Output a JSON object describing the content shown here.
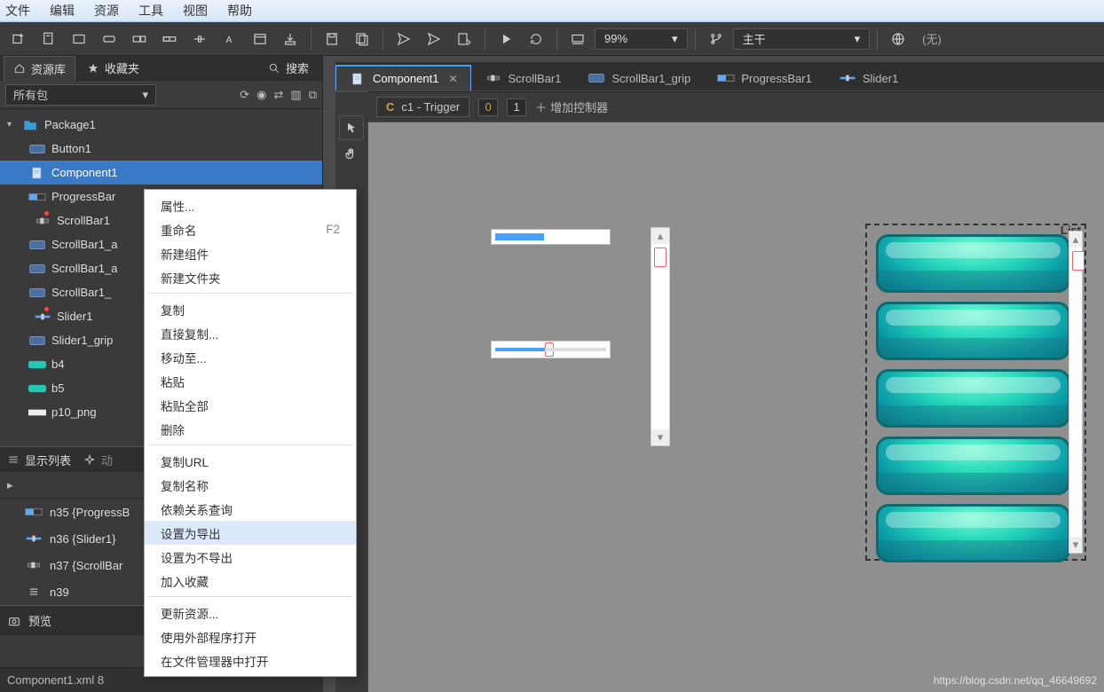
{
  "menubar": [
    "文件",
    "编辑",
    "资源",
    "工具",
    "视图",
    "帮助"
  ],
  "toolbar": {
    "zoom": "99%",
    "trunk": "主干",
    "tone": "(无)"
  },
  "libtabs": {
    "library": "资源库",
    "favorites": "收藏夹",
    "search": "搜索"
  },
  "pkg_selector": "所有包",
  "tree": {
    "root": "Package1",
    "items": [
      {
        "label": "Button1",
        "icon": "button"
      },
      {
        "label": "Component1",
        "icon": "component",
        "selected": true
      },
      {
        "label": "ProgressBar",
        "icon": "progress",
        "truncated": true
      },
      {
        "label": "ScrollBar1",
        "icon": "scrollbar",
        "dot": true
      },
      {
        "label": "ScrollBar1_a",
        "icon": "button",
        "truncated": true
      },
      {
        "label": "ScrollBar1_a",
        "icon": "button",
        "truncated": true
      },
      {
        "label": "ScrollBar1_",
        "icon": "button",
        "truncated": true
      },
      {
        "label": "Slider1",
        "icon": "slider",
        "dot": true
      },
      {
        "label": "Slider1_grip",
        "icon": "button",
        "truncated": true
      },
      {
        "label": "b4",
        "icon": "img-teal"
      },
      {
        "label": "b5",
        "icon": "img-teal"
      },
      {
        "label": "p10_png",
        "icon": "img-white"
      }
    ]
  },
  "disp": {
    "title": "显示列表",
    "anim_tab": "动",
    "items": [
      "n35 {ProgressB",
      "n36 {Slider1}",
      "n37 {ScrollBar",
      "n39"
    ],
    "preview": "预览"
  },
  "status": "Component1.xml  8",
  "tabs": [
    {
      "label": "Component1",
      "active": true,
      "icon": "component",
      "close": true
    },
    {
      "label": "ScrollBar1",
      "icon": "scrollbar"
    },
    {
      "label": "ScrollBar1_grip",
      "icon": "button"
    },
    {
      "label": "ProgressBar1",
      "icon": "progress"
    },
    {
      "label": "Slider1",
      "icon": "slider"
    }
  ],
  "controller": {
    "chip_prefix": "C",
    "chip_text": "c1 - Trigger",
    "box0": "0",
    "box1": "1",
    "add": "增加控制器"
  },
  "list_label": "List",
  "contextmenu": [
    {
      "label": "属性...",
      "type": "item"
    },
    {
      "label": "重命名",
      "accel": "F2",
      "type": "item"
    },
    {
      "label": "新建组件",
      "type": "item"
    },
    {
      "label": "新建文件夹",
      "type": "item"
    },
    {
      "type": "sep"
    },
    {
      "label": "复制",
      "type": "item"
    },
    {
      "label": "直接复制...",
      "type": "item"
    },
    {
      "label": "移动至...",
      "type": "item"
    },
    {
      "label": "粘贴",
      "type": "item"
    },
    {
      "label": "粘贴全部",
      "type": "item"
    },
    {
      "label": "删除",
      "type": "item"
    },
    {
      "type": "sep"
    },
    {
      "label": "复制URL",
      "type": "item"
    },
    {
      "label": "复制名称",
      "type": "item"
    },
    {
      "label": "依赖关系查询",
      "type": "item"
    },
    {
      "label": "设置为导出",
      "type": "item",
      "hovered": true
    },
    {
      "label": "设置为不导出",
      "type": "item"
    },
    {
      "label": "加入收藏",
      "type": "item"
    },
    {
      "type": "sep"
    },
    {
      "label": "更新资源...",
      "type": "item"
    },
    {
      "label": "使用外部程序打开",
      "type": "item"
    },
    {
      "label": "在文件管理器中打开",
      "type": "item"
    }
  ],
  "watermark": "https://blog.csdn.net/qq_46649692"
}
